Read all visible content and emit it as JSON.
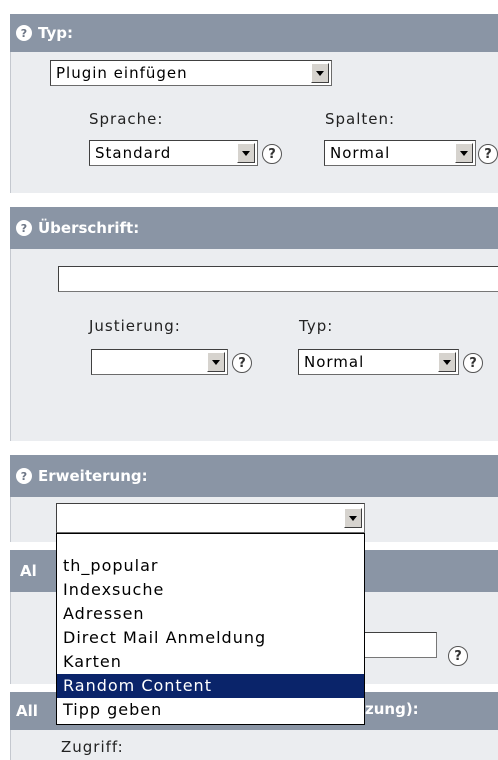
{
  "sections": {
    "typ": {
      "title": "Typ:",
      "select_value": "Plugin einfügen",
      "sprache_label": "Sprache:",
      "sprache_value": "Standard",
      "spalten_label": "Spalten:",
      "spalten_value": "Normal"
    },
    "ueberschrift": {
      "title": "Überschrift:",
      "input_value": "",
      "justierung_label": "Justierung:",
      "justierung_value": "",
      "typ_label": "Typ:",
      "typ_value": "Normal"
    },
    "erweiterung": {
      "title": "Erweiterung:",
      "select_value": ""
    },
    "allgemein1": {
      "title_fragment": "Al"
    },
    "allgemein2": {
      "title_fragment_left": "All",
      "title_fragment_right": "zung):"
    },
    "zugriff": {
      "label": "Zugriff:"
    }
  },
  "dropdown": {
    "options": [
      "th_popular",
      "Indexsuche",
      "Adressen",
      "Direct Mail Anmeldung",
      "Karten",
      "Random Content",
      "Tipp geben"
    ],
    "selected": "Random Content"
  },
  "help_glyph": "?",
  "colors": {
    "header_bg": "#8a95a5",
    "section_bg": "#ebedf0",
    "selection_bg": "#0a246a"
  }
}
